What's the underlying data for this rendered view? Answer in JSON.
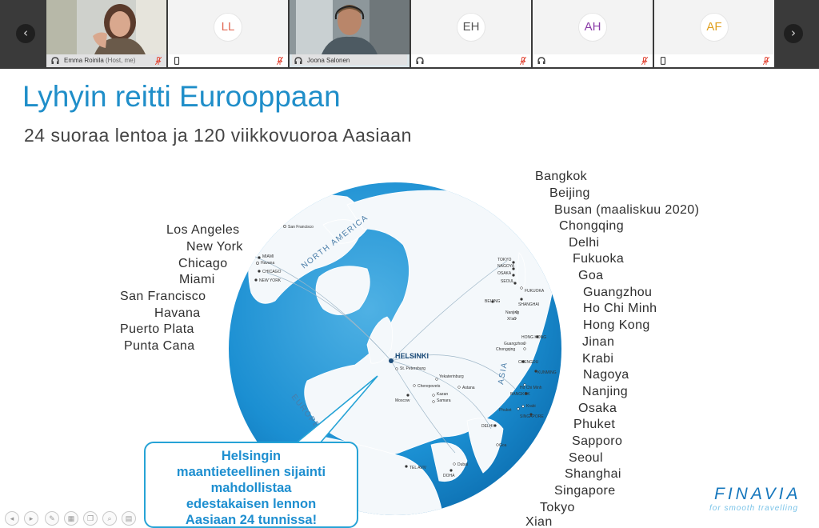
{
  "meeting": {
    "participants": [
      {
        "name": "Emma Roinila",
        "role": " (Host, me)",
        "type": "video"
      },
      {
        "initials": "LL",
        "name": "",
        "type": "avatar",
        "color": "#e26a55"
      },
      {
        "name": "Joona Salonen",
        "role": "",
        "type": "video",
        "active": true
      },
      {
        "initials": "EH",
        "name": "",
        "type": "avatar",
        "color": "#555555"
      },
      {
        "initials": "AH",
        "name": "",
        "type": "avatar",
        "color": "#8b3da8"
      },
      {
        "initials": "AF",
        "name": "",
        "type": "avatar",
        "color": "#e0a020"
      }
    ],
    "nav_prev": "‹",
    "nav_next": "›"
  },
  "slide": {
    "title": "Lyhyin reitti Eurooppaan",
    "subtitle": "24 suoraa lentoa ja 120 viikkovuoroa Aasiaan",
    "west_cities": [
      "Los Angeles",
      "New York",
      "Chicago",
      "Miami",
      "San Francisco",
      "Havana",
      "Puerto Plata",
      "Punta Cana"
    ],
    "asia_cities": [
      "Bangkok",
      "Beijing",
      "Busan (maaliskuu 2020)",
      "Chongqing",
      "Delhi",
      "Fukuoka",
      "Goa",
      "Guangzhou",
      "Ho Chi Minh",
      "Hong Kong",
      "Jinan",
      "Krabi",
      "Nagoya",
      "Nanjing",
      "Osaka",
      "Phuket",
      "Sapporo",
      "Seoul",
      "Shanghai",
      "Singapore",
      "Tokyo",
      "Xian"
    ],
    "map": {
      "region_labels": {
        "north_america": "NORTH AMERICA",
        "europe": "EUROPE",
        "asia": "ASIA"
      },
      "hub": "HELSINKI",
      "west_points": [
        "San Francisco",
        "MIAMI",
        "Havana",
        "CHICAGO",
        "NEW YORK"
      ],
      "europe_points": [
        "St. Petersburg",
        "Moscow",
        "Yekaterinburg",
        "Cherepovets",
        "Kazan",
        "Samara",
        "Astana",
        "TEL AVIV",
        "Dubai",
        "DOHA"
      ],
      "asia_points": [
        "TOKYO",
        "NAGOYA",
        "OSAKA",
        "SEOUL",
        "FUKUOKA",
        "BEIJING",
        "SHANGHAI",
        "Nanjing",
        "Xi'an",
        "HONG KONG",
        "Guangzhou",
        "Chongqing",
        "CHENGDU",
        "KUNMING",
        "Ho Chi Minh",
        "BANGKOK",
        "Krabi",
        "Phuket",
        "SINGAPORE",
        "DELHI",
        "Goa"
      ],
      "ocean_color": "#1b8fd2",
      "land_color": "#f4f8fb"
    },
    "callout": "Helsingin\nmaantieteellinen sijainti\nmahdollistaa\nedestakaisen lennon\nAasiaan 24 tunnissa!",
    "logo": {
      "wordmark": "FINAVIA",
      "tagline": "for smooth travelling"
    }
  }
}
